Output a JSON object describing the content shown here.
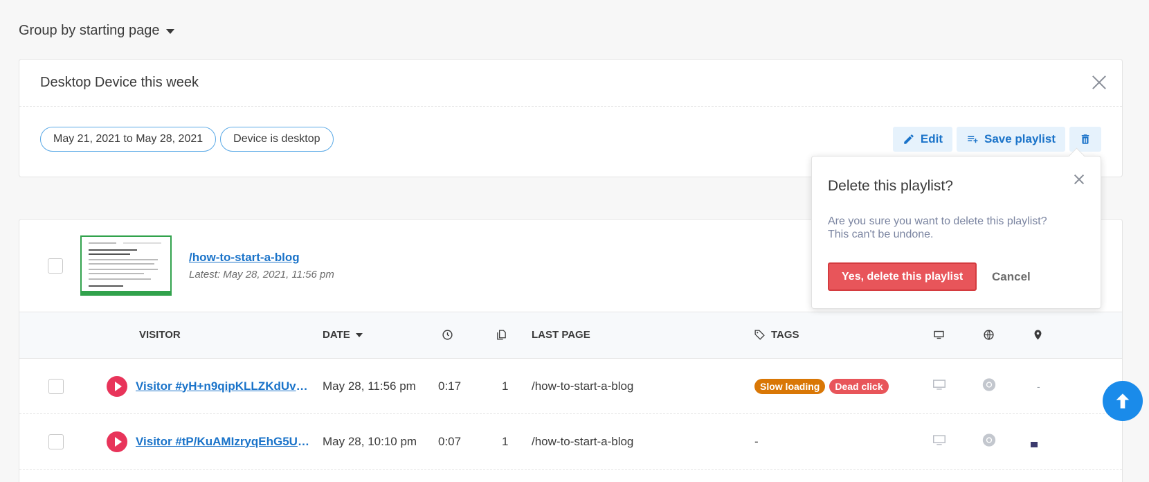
{
  "groupby": {
    "label": "Group by starting page"
  },
  "filter": {
    "title": "Desktop Device this week",
    "chips": [
      "May 21, 2021 to May 28, 2021",
      "Device is desktop"
    ],
    "actions": {
      "edit": "Edit",
      "save": "Save playlist"
    }
  },
  "group": {
    "page": "/how-to-start-a-blog",
    "latest": "Latest: May 28, 2021, 11:56 pm"
  },
  "columns": {
    "visitor": "VISITOR",
    "date": "DATE",
    "last_page": "LAST PAGE",
    "tags": "TAGS"
  },
  "rows": [
    {
      "visitor": "Visitor #yH+n9qipKLLZKdUv1fJE...",
      "date": "May 28, 11:56 pm",
      "duration": "0:17",
      "pages": "1",
      "last_page": "/how-to-start-a-blog",
      "tags": [
        {
          "label": "Slow loading",
          "color": "#d97706"
        },
        {
          "label": "Dead click",
          "color": "#e8555a"
        }
      ],
      "location": "-"
    },
    {
      "visitor": "Visitor #tP/KuAMIzryqEhG5UZT...",
      "date": "May 28, 10:10 pm",
      "duration": "0:07",
      "pages": "1",
      "last_page": "/how-to-start-a-blog",
      "tags_empty": "-",
      "location_icon": "us-flag-icon"
    }
  ],
  "popover": {
    "title": "Delete this playlist?",
    "message": "Are you sure you want to delete this playlist? This can't be undone.",
    "confirm": "Yes, delete this playlist",
    "cancel": "Cancel"
  },
  "colors": {
    "accent": "#1a73c9",
    "danger": "#e8555a",
    "play": "#e8345a",
    "scroll_top": "#1a8bea"
  }
}
